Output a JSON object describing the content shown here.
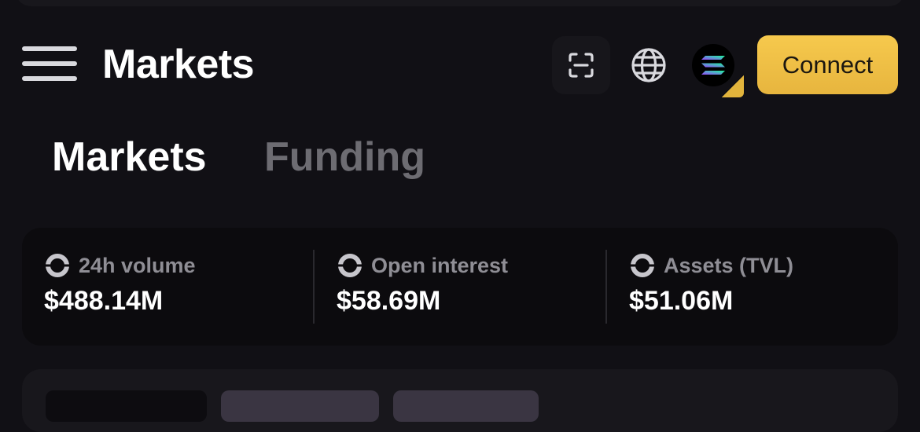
{
  "header": {
    "title": "Markets",
    "connect_label": "Connect",
    "icons": {
      "menu": "hamburger-menu-icon",
      "scan": "scan-icon",
      "globe": "globe-icon",
      "chain": "solana-logo-icon"
    }
  },
  "tabs": [
    {
      "label": "Markets",
      "active": true
    },
    {
      "label": "Funding",
      "active": false
    }
  ],
  "stats": [
    {
      "label": "24h volume",
      "value": "$488.14M",
      "icon": "coin-icon"
    },
    {
      "label": "Open interest",
      "value": "$58.69M",
      "icon": "coin-icon"
    },
    {
      "label": "Assets (TVL)",
      "value": "$51.06M",
      "icon": "coin-icon"
    }
  ],
  "colors": {
    "background": "#111015",
    "accent": "#F2C14A",
    "muted_text": "#8F8E95",
    "inactive_tab": "#6D6C72"
  }
}
